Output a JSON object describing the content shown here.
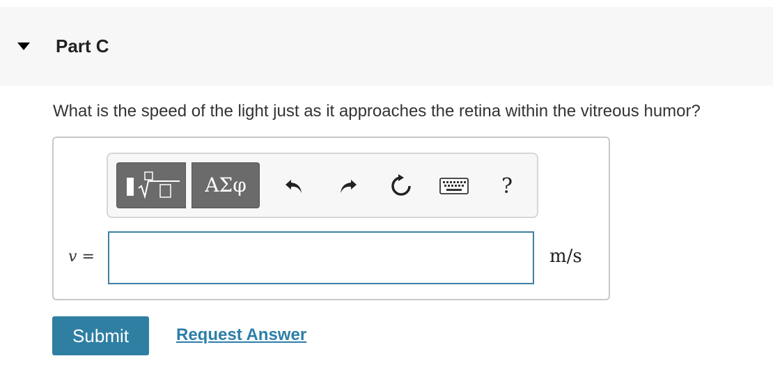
{
  "part": {
    "title": "Part C"
  },
  "question": {
    "text": "What is the speed of the light just as it approaches the retina within the vitreous humor?"
  },
  "toolbar": {
    "template_icon": "fraction-root-template-icon",
    "greek_label": "ΑΣφ",
    "undo_icon": "undo-icon",
    "redo_icon": "redo-icon",
    "reset_icon": "reset-icon",
    "keyboard_icon": "keyboard-icon",
    "help_label": "?"
  },
  "answer": {
    "variable": "v",
    "equals": "=",
    "value": "",
    "units": "m/s"
  },
  "actions": {
    "submit_label": "Submit",
    "request_label": "Request Answer"
  },
  "colors": {
    "accent": "#2f7fa3",
    "link": "#2d7ea8",
    "input_border": "#3e7fa3",
    "toolbar_button": "#6b6b6b"
  }
}
